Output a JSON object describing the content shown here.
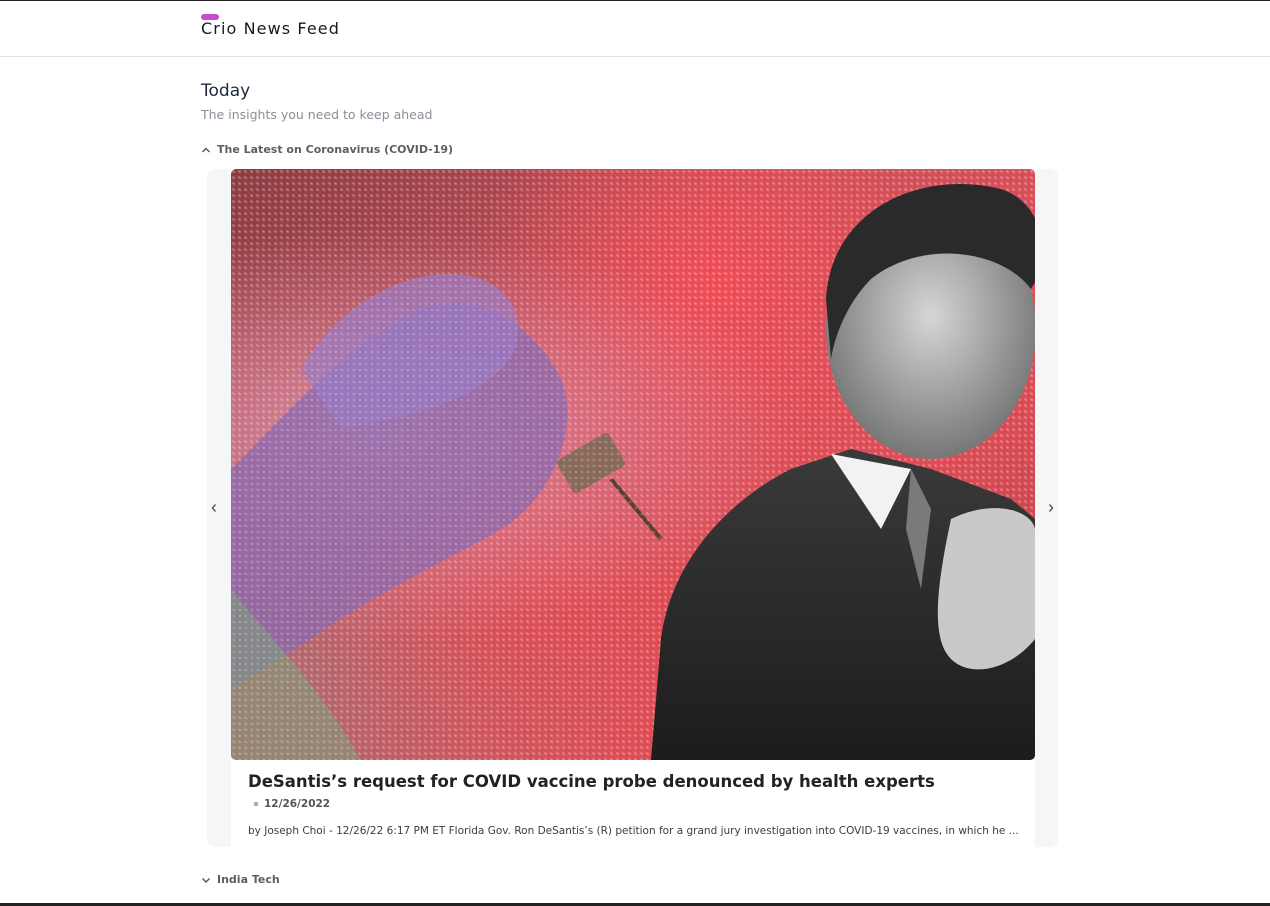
{
  "app": {
    "brand_title": "Crio News Feed"
  },
  "page": {
    "title": "Today",
    "subtitle": "The insights you need to keep ahead"
  },
  "sections": [
    {
      "title": "The Latest on Coronavirus (COVID-19)",
      "expanded": true,
      "chevron_icon": "chevron-up-icon",
      "article": {
        "title": "DeSantis’s request for COVID vaccine probe denounced by health experts",
        "date": "12/26/2022",
        "description": "by Joseph Choi - 12/26/22 6:17 PM ET Florida Gov. Ron DeSantis’s (R) petition for a grand jury investigation into COVID-19 vaccines, in which he ..."
      }
    },
    {
      "title": "India Tech",
      "expanded": false,
      "chevron_icon": "chevron-down-icon"
    }
  ],
  "carousel": {
    "prev_icon": "chevron-left-icon",
    "next_icon": "chevron-right-icon"
  },
  "colors": {
    "brand_accent": "#c84bd1",
    "navbar_border": "#dfe3e8",
    "carousel_bg": "#f5f6f8"
  }
}
